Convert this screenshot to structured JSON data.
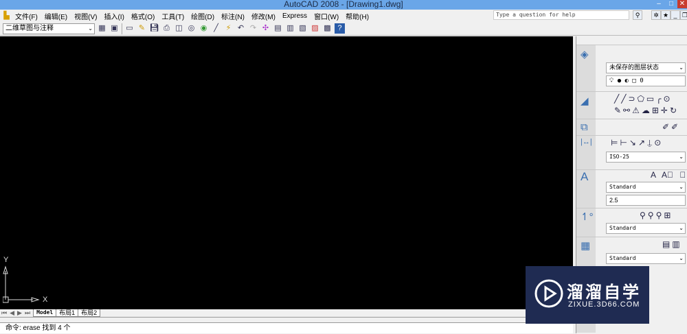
{
  "title": "AutoCAD 2008 - [Drawing1.dwg]",
  "menu": [
    "文件(F)",
    "编辑(E)",
    "视图(V)",
    "插入(I)",
    "格式(O)",
    "工具(T)",
    "绘图(D)",
    "标注(N)",
    "修改(M)",
    "Express",
    "窗口(W)",
    "帮助(H)"
  ],
  "help_placeholder": "Type a question for help",
  "workspace": "二维草图与注释",
  "tabs": [
    "Model",
    "布局1",
    "布局2"
  ],
  "command": "命令:  erase 找到 4 个",
  "ucs": {
    "x": "X",
    "y": "Y"
  },
  "palette": {
    "layer_state": "未保存的图层状态",
    "layer_current": "0",
    "dim_style": "ISO-25",
    "text_style": "Standard",
    "text_height": "2.5",
    "mleader_style": "Standard",
    "table_style": "Standard"
  },
  "watermark": {
    "name": "溜溜自学",
    "url": "ZIXUE.3D66.COM"
  }
}
